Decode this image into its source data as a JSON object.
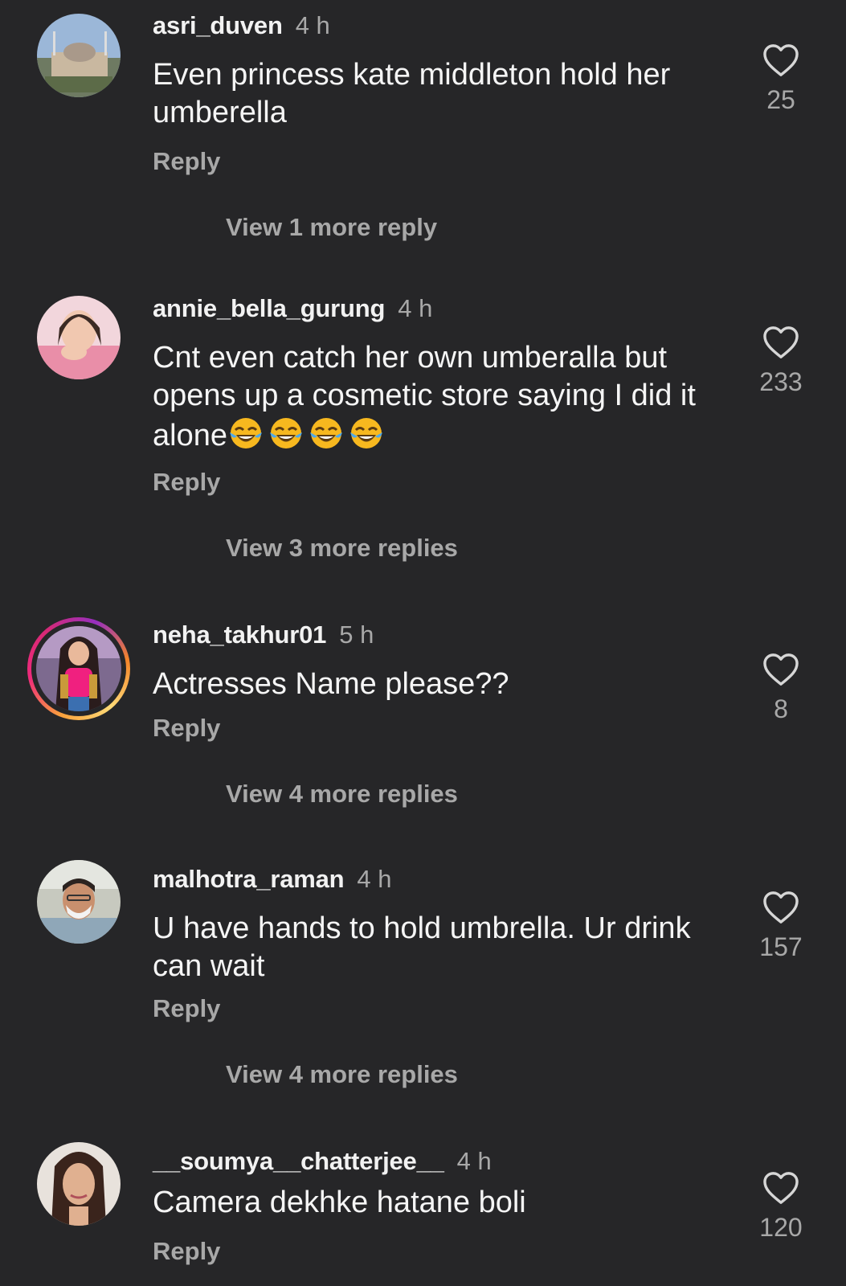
{
  "comments": [
    {
      "username": "asri_duven",
      "time": "4 h",
      "text": "Even princess kate middleton hold her umberella",
      "likes": "25",
      "reply_label": "Reply",
      "view_more": "View 1 more reply"
    },
    {
      "username": "annie_bella_gurung",
      "time": "4 h",
      "text": "Cnt even catch her own umberalla but opens up a cosmetic store  saying I did it alone",
      "emoji": "😂😂😂😂",
      "likes": "233",
      "reply_label": "Reply",
      "view_more": "View 3 more replies"
    },
    {
      "username": "neha_takhur01",
      "time": "5 h",
      "text": "Actresses Name please??",
      "likes": "8",
      "reply_label": "Reply",
      "view_more": "View 4 more replies"
    },
    {
      "username": "malhotra_raman",
      "time": "4 h",
      "text": "U have hands to hold umbrella. Ur drink can wait",
      "likes": "157",
      "reply_label": "Reply",
      "view_more": "View 4 more replies"
    },
    {
      "username": "__soumya__chatterjee__",
      "time": "4 h",
      "text": "Camera dekhke hatane boli",
      "likes": "120",
      "reply_label": "Reply"
    }
  ],
  "icons": {
    "like": "heart-outline-icon",
    "emoji": "face-with-tears-of-joy"
  },
  "colors": {
    "background": "#262628",
    "primary_text": "#f5f5f5",
    "secondary_text": "#a8a8a8"
  }
}
